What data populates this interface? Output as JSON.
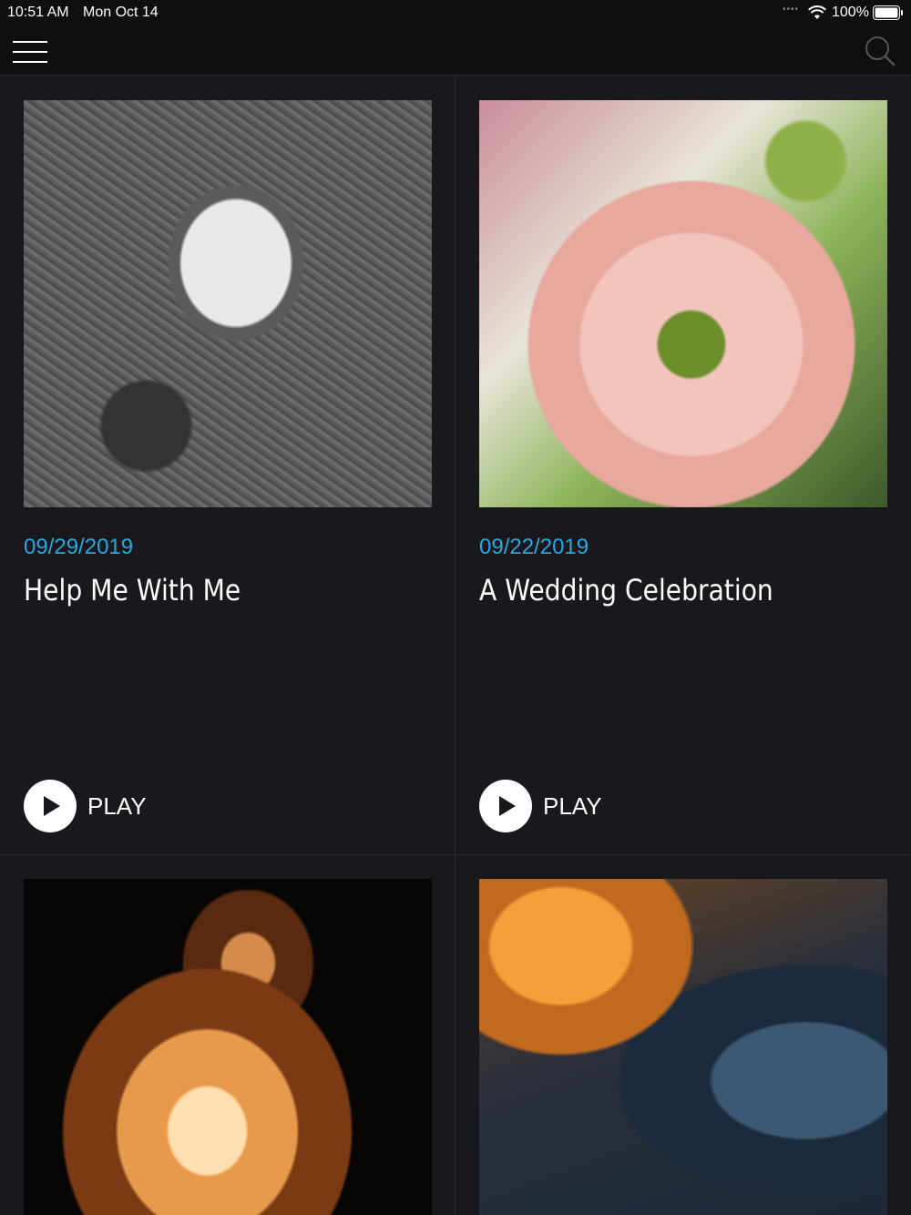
{
  "status_bar": {
    "time": "10:51 AM",
    "date": "Mon Oct 14",
    "battery": "100%"
  },
  "nav": {
    "menu_icon": "hamburger-menu-icon",
    "search_icon": "search-icon"
  },
  "colors": {
    "background": "#19181c",
    "date_accent": "#29a8e0",
    "text": "#ffffff"
  },
  "cards": [
    {
      "date": "09/29/2019",
      "title": "Help Me With Me",
      "play_label": "PLAY"
    },
    {
      "date": "09/22/2019",
      "title": "A Wedding Celebration",
      "play_label": "PLAY"
    },
    {
      "date": "",
      "title": "",
      "play_label": ""
    },
    {
      "date": "",
      "title": "",
      "play_label": ""
    }
  ]
}
